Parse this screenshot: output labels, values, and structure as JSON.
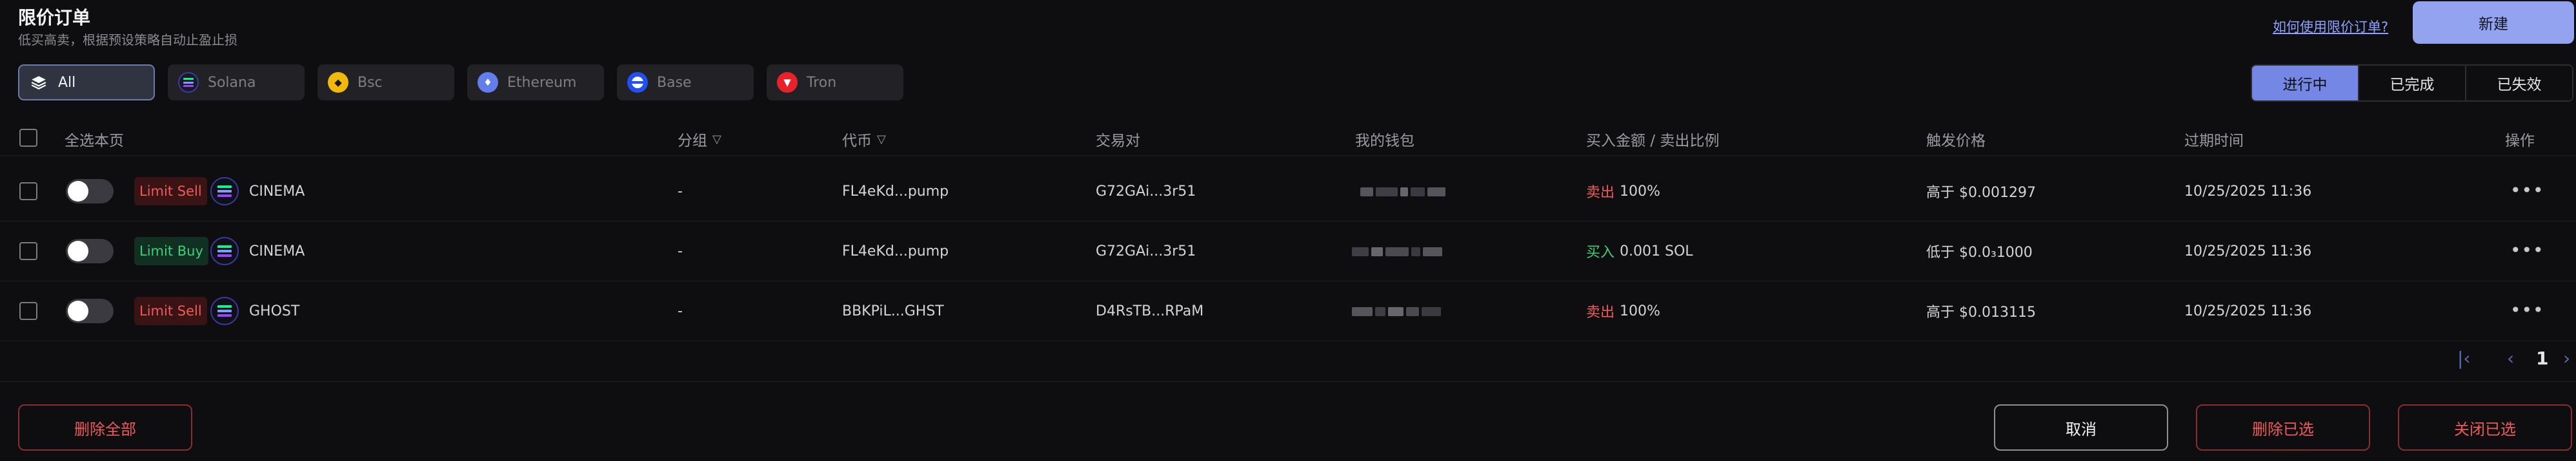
{
  "header": {
    "title": "限价订单",
    "subtitle": "低买高卖，根据预设策略自动止盈止损",
    "help_link": "如何使用限价订单?",
    "new_button": "新建"
  },
  "chains": [
    {
      "label": "All",
      "icon": "layers-icon",
      "color": "#ffffff"
    },
    {
      "label": "Solana",
      "icon": "solana-icon",
      "color": "#1a1a24"
    },
    {
      "label": "Bsc",
      "icon": "bsc-icon",
      "color": "#f0b90b"
    },
    {
      "label": "Ethereum",
      "icon": "ethereum-icon",
      "color": "#627eea"
    },
    {
      "label": "Base",
      "icon": "base-icon",
      "color": "#2151f5"
    },
    {
      "label": "Tron",
      "icon": "tron-icon",
      "color": "#e6232b"
    }
  ],
  "status_tabs": [
    "进行中",
    "已完成",
    "已失效"
  ],
  "columns": {
    "select_all": "全选本页",
    "group": "分组",
    "token": "代币",
    "pair": "交易对",
    "wallet": "我的钱包",
    "amount": "买入金额 / 卖出比例",
    "trigger": "触发价格",
    "expiry": "过期时间",
    "actions": "操作"
  },
  "rows": [
    {
      "type": "Limit Sell",
      "side": "sell",
      "token": "CINEMA",
      "group": "-",
      "token_addr": "FL4eKd...pump",
      "pair": "G72GAi...3r51",
      "side_label": "卖出",
      "amount": "100%",
      "trigger": "高于 $0.001297",
      "expiry": "10/25/2025 11:36"
    },
    {
      "type": "Limit Buy",
      "side": "buy",
      "token": "CINEMA",
      "group": "-",
      "token_addr": "FL4eKd...pump",
      "pair": "G72GAi...3r51",
      "side_label": "买入",
      "amount": "0.001 SOL",
      "trigger": "低于 $0.0₃1000",
      "expiry": "10/25/2025 11:36"
    },
    {
      "type": "Limit Sell",
      "side": "sell",
      "token": "GHOST",
      "group": "-",
      "token_addr": "BBKPiL...GHST",
      "pair": "D4RsTB...RPaM",
      "side_label": "卖出",
      "amount": "100%",
      "trigger": "高于 $0.013115",
      "expiry": "10/25/2025 11:36"
    }
  ],
  "pagination": {
    "current_page": "1"
  },
  "footer": {
    "delete_all": "删除全部",
    "cancel": "取消",
    "delete_selected": "删除已选",
    "close_selected": "关闭已选"
  },
  "colors": {
    "accent": "#7487e4",
    "sell": "#f05a5a",
    "buy": "#3fcf7a"
  }
}
